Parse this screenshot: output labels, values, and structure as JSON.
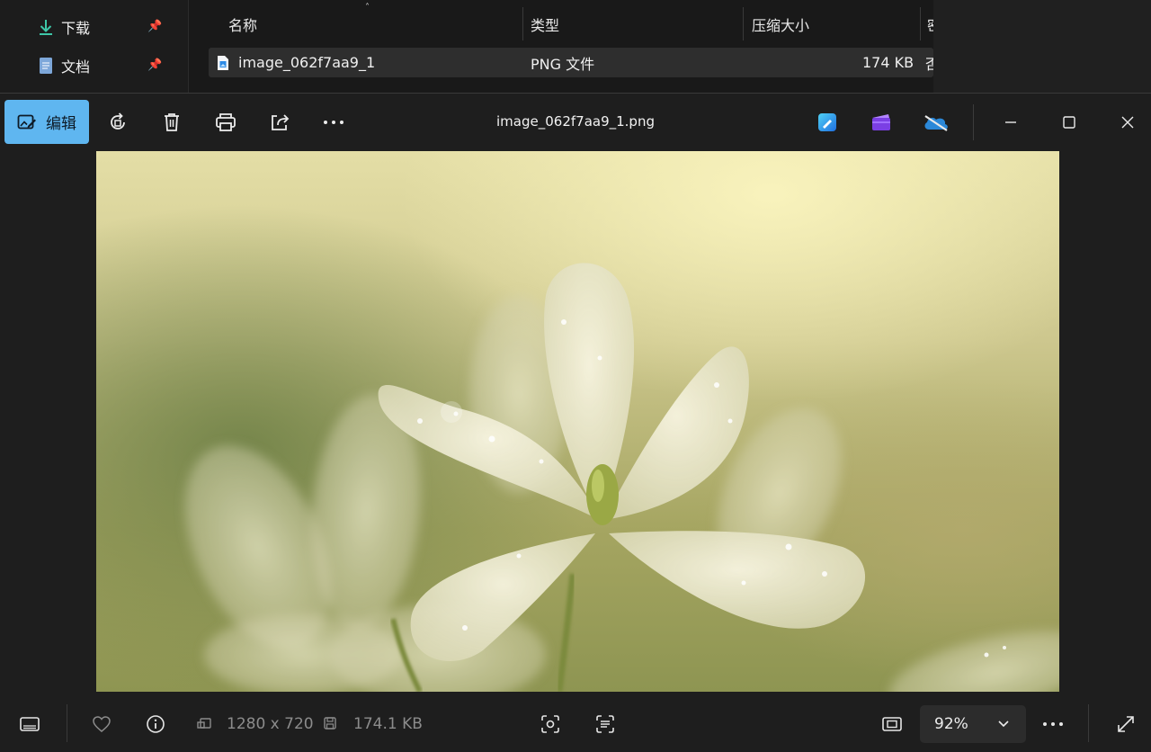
{
  "explorer": {
    "nav_items": [
      {
        "label": "下载",
        "icon": "download-icon"
      },
      {
        "label": "文档",
        "icon": "document-icon"
      }
    ],
    "columns": {
      "name": "名称",
      "type": "类型",
      "compressed_size": "压缩大小",
      "cut_off": "密"
    },
    "file_row": {
      "name": "image_062f7aa9_1",
      "type": "PNG 文件",
      "size": "174 KB",
      "cut_off": "否"
    }
  },
  "viewer": {
    "edit_label": "编辑",
    "title": "image_062f7aa9_1.png",
    "toolbar_icons": [
      "rotate-icon",
      "delete-icon",
      "print-icon",
      "share-icon",
      "more-icon",
      "designer-icon",
      "clipchamp-icon",
      "onedrive-icon"
    ],
    "window_controls": [
      "minimize-icon",
      "maximize-icon",
      "close-icon"
    ]
  },
  "statusbar": {
    "dimensions": "1280 x 720",
    "filesize": "174.1 KB",
    "zoom": "92%"
  },
  "colors": {
    "accent": "#5fb6f0",
    "background": "#1e1e1e",
    "muted_text": "#8c8c8c"
  }
}
